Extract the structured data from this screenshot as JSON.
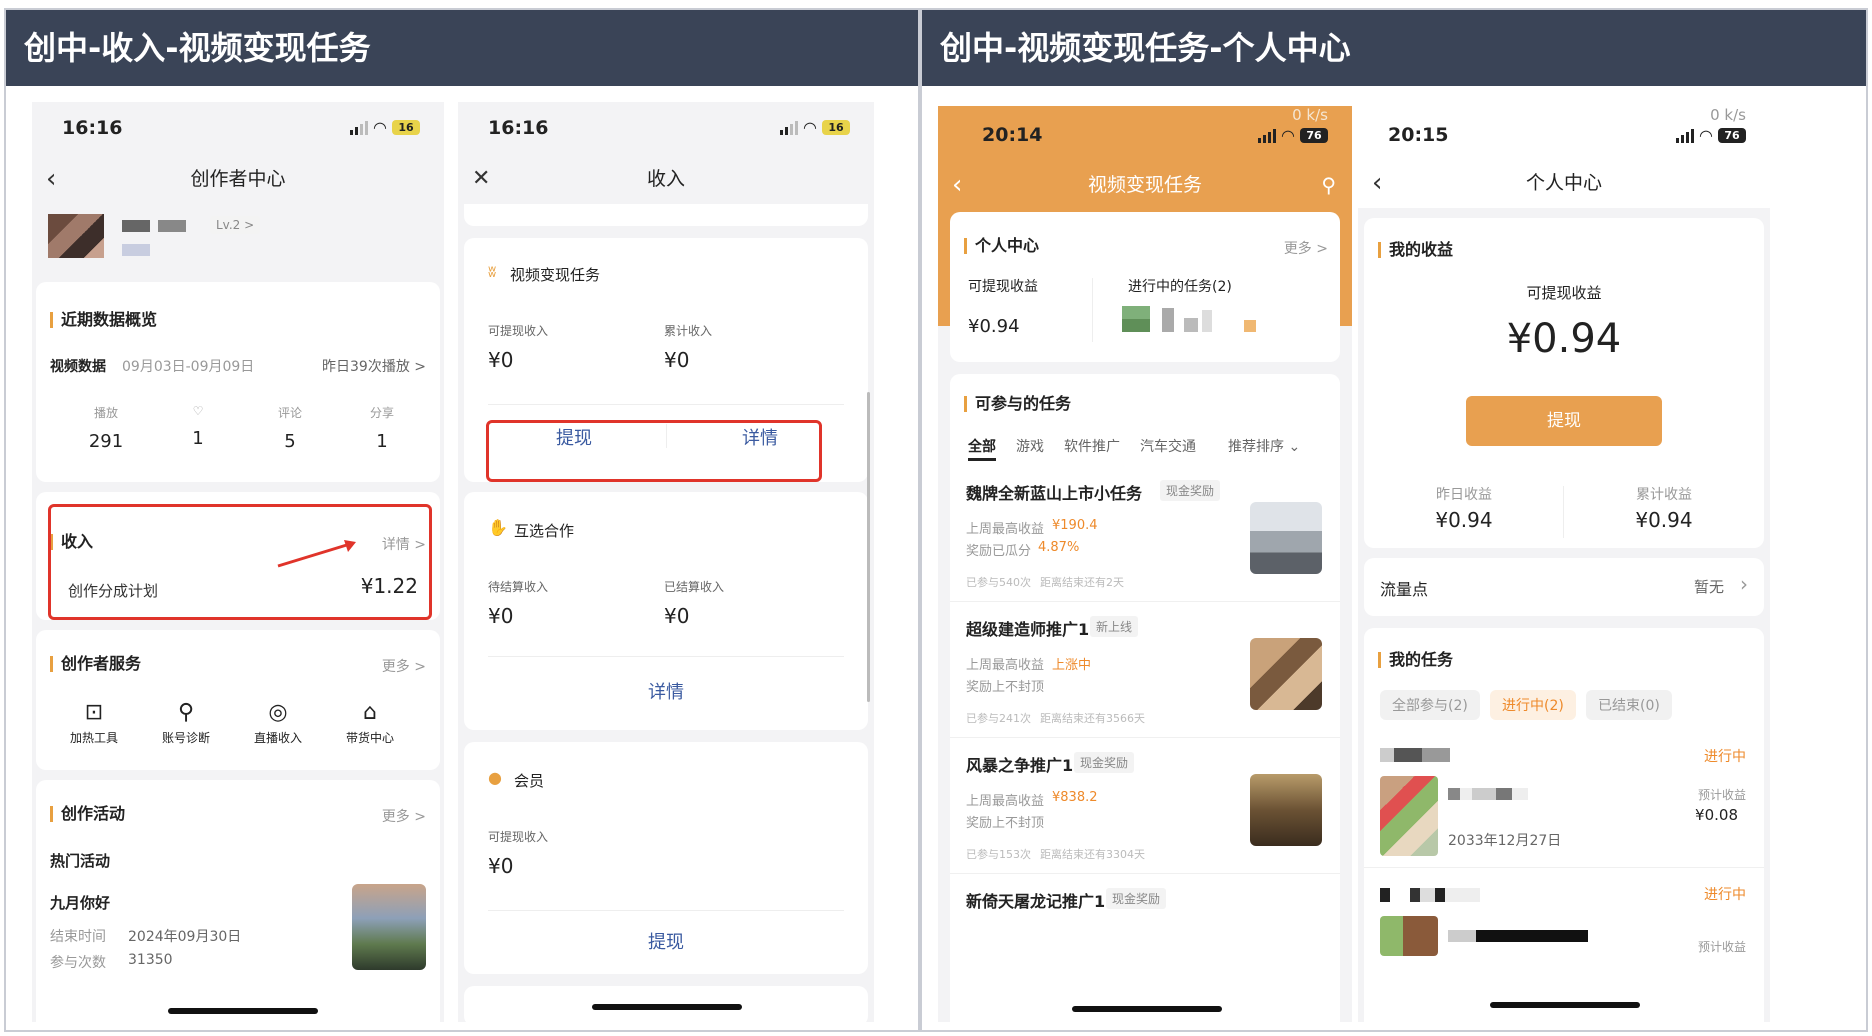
{
  "left_panel": {
    "title": "创中-收入-视频变现任务"
  },
  "right_panel": {
    "title": "创中-视频变现任务-个人中心"
  },
  "phone1": {
    "time": "16:16",
    "battery": "16",
    "nav_title": "创作者中心",
    "level": "Lv.2 >",
    "overview": {
      "title": "近期数据概览",
      "label": "视频数据",
      "range": "09月03日-09月09日",
      "yesterday": "昨日39次播放 >",
      "stats": [
        {
          "label": "播放",
          "value": "291"
        },
        {
          "label": "♡",
          "value": "1"
        },
        {
          "label": "评论",
          "value": "5"
        },
        {
          "label": "分享",
          "value": "1"
        }
      ]
    },
    "income": {
      "title": "收入",
      "detail": "详情 >",
      "item": "创作分成计划",
      "amount": "¥1.22"
    },
    "services": {
      "title": "创作者服务",
      "more": "更多 >",
      "items": [
        "加热工具",
        "账号诊断",
        "直播收入",
        "带货中心"
      ]
    },
    "activity": {
      "title": "创作活动",
      "more": "更多 >",
      "hot": "热门活动",
      "name": "九月你好",
      "end_label": "结束时间",
      "end": "2024年09月30日",
      "count_label": "参与次数",
      "count": "31350"
    }
  },
  "phone2": {
    "time": "16:16",
    "battery": "16",
    "nav_title": "收入",
    "video": {
      "title": "视频变现任务",
      "withdrawable": "可提现收入",
      "total": "累计收入",
      "v1": "¥0",
      "v2": "¥0",
      "btn1": "提现",
      "btn2": "详情"
    },
    "mutual": {
      "title": "互选合作",
      "pending": "待结算收入",
      "settled": "已结算收入",
      "v1": "¥0",
      "v2": "¥0",
      "btn": "详情"
    },
    "member": {
      "title": "会员",
      "withdrawable": "可提现收入",
      "v1": "¥0",
      "btn": "提现"
    }
  },
  "phone3": {
    "time": "20:14",
    "battery": "76",
    "speed": "0 k/s",
    "nav_title": "视频变现任务",
    "personal": {
      "title": "个人中心",
      "more": "更多 >",
      "withdrawable": "可提现收益",
      "amount": "¥0.94",
      "ongoing": "进行中的任务(2)"
    },
    "tasks": {
      "title": "可参与的任务",
      "tabs": [
        "全部",
        "游戏",
        "软件推广",
        "汽车交通"
      ],
      "sort": "推荐排序 ⌄",
      "items": [
        {
          "name": "魏牌全新蓝山上市小任务",
          "tag": "现金奖励",
          "l1": "上周最高收益",
          "v1": "¥190.4",
          "l2": "奖励已瓜分",
          "v2": "4.87%",
          "foot1": "已参与540次",
          "foot2": "距离结束还有2天"
        },
        {
          "name": "超级建造师推广1",
          "tag": "新上线",
          "l1": "上周最高收益",
          "v1": "上涨中",
          "l2": "奖励上不封顶",
          "v2": "",
          "foot1": "已参与241次",
          "foot2": "距离结束还有3566天"
        },
        {
          "name": "风暴之争推广1",
          "tag": "现金奖励",
          "l1": "上周最高收益",
          "v1": "¥838.2",
          "l2": "奖励上不封顶",
          "v2": "",
          "foot1": "已参与153次",
          "foot2": "距离结束还有3304天"
        },
        {
          "name": "新倚天屠龙记推广1",
          "tag": "现金奖励"
        }
      ]
    }
  },
  "phone4": {
    "time": "20:15",
    "battery": "76",
    "speed": "0 k/s",
    "nav_title": "个人中心",
    "earnings": {
      "title": "我的收益",
      "withdrawable": "可提现收益",
      "amount": "¥0.94",
      "btn": "提现",
      "yesterday": "昨日收益",
      "yv": "¥0.94",
      "total": "累计收益",
      "tv": "¥0.94"
    },
    "traffic": {
      "label": "流量点",
      "value": "暂无"
    },
    "mytasks": {
      "title": "我的任务",
      "filters": [
        "全部参与(2)",
        "进行中(2)",
        "已结束(0)"
      ],
      "status1": "进行中",
      "est_label": "预计收益",
      "est": "¥0.08",
      "date": "2033年12月27日",
      "status2": "进行中",
      "est_label2": "预计收益"
    }
  },
  "colors": {
    "accent": "#e8a050",
    "red_box": "#e0342a",
    "header": "#3a4457"
  }
}
